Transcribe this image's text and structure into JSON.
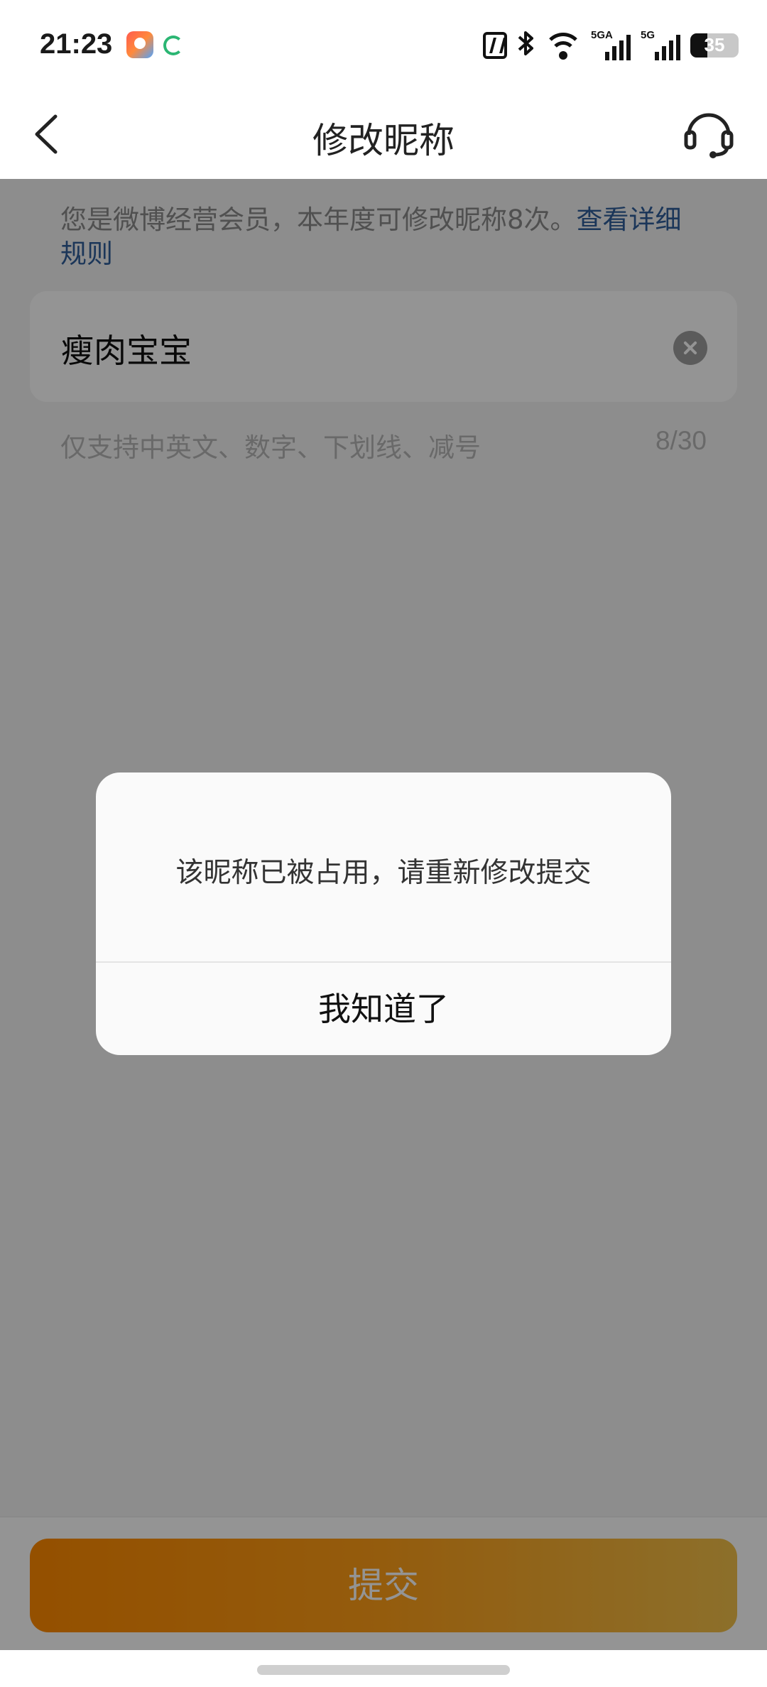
{
  "status_bar": {
    "time": "21:23",
    "signal_1_label": "5GA",
    "signal_2_label": "5G",
    "battery": "35",
    "battery_level_percent": 35
  },
  "header": {
    "title": "修改昵称",
    "back_icon": "chevron-left-icon",
    "service_icon": "headset-icon"
  },
  "main": {
    "notice_text": "您是微博经营会员，本年度可修改昵称8次。",
    "notice_link": "查看详细规则",
    "nickname_value": "瘦肉宝宝",
    "hint": "仅支持中英文、数字、下划线、减号",
    "counter": "8/30"
  },
  "footer": {
    "submit_label": "提交"
  },
  "dialog": {
    "message": "该昵称已被占用，请重新修改提交",
    "confirm_label": "我知道了"
  },
  "colors": {
    "link": "#2f5d9a",
    "submit_gradient_start": "#ff8a00",
    "submit_gradient_end": "#f2c04a",
    "overlay": "rgba(0,0,0,0.42)"
  }
}
